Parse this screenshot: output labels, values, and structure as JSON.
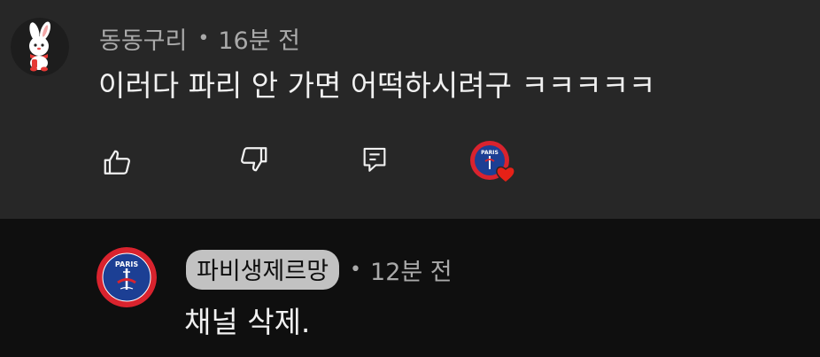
{
  "comment": {
    "author": "동동구리",
    "separator": "•",
    "time": "16분 전",
    "text": "이러다 파리 안 가면 어떡하시려구 ㅋㅋㅋㅋㅋ",
    "icons": {
      "avatar": "rabbit-avatar-icon",
      "like": "thumbs-up-icon",
      "dislike": "thumbs-down-icon",
      "reply": "reply-icon",
      "creator_heart": "creator-heart-icon"
    }
  },
  "reply": {
    "author": "파비생제르망",
    "separator": "•",
    "time": "12분 전",
    "text": "채널 삭제.",
    "icons": {
      "avatar": "psg-crest-avatar-icon"
    }
  },
  "colors": {
    "top_background": "#272727",
    "reply_background": "#0f0f0f",
    "meta_text": "#aaaaaa",
    "body_text": "#f1f1f1",
    "heart": "#e62117",
    "psg_blue": "#1c3f94",
    "psg_red": "#d9232e",
    "creator_chip": "#c2c2c2"
  }
}
